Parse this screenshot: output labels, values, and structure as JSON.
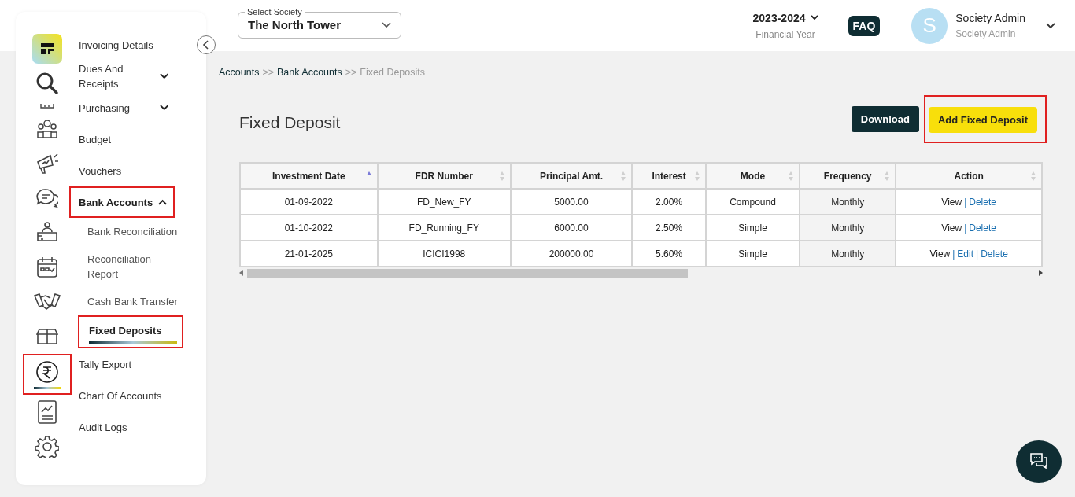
{
  "rail": [
    {
      "kind": "logo",
      "selected": false,
      "highlighted": false
    },
    {
      "kind": "search",
      "selected": false,
      "highlighted": false
    },
    {
      "kind": "partial",
      "selected": false,
      "highlighted": false
    },
    {
      "kind": "people",
      "selected": false,
      "highlighted": false
    },
    {
      "kind": "megaphone",
      "selected": false,
      "highlighted": false
    },
    {
      "kind": "chat",
      "selected": false,
      "highlighted": false
    },
    {
      "kind": "desk",
      "selected": false,
      "highlighted": false
    },
    {
      "kind": "calendar",
      "selected": false,
      "highlighted": false
    },
    {
      "kind": "handshake",
      "selected": false,
      "highlighted": false
    },
    {
      "kind": "box",
      "selected": false,
      "highlighted": false
    },
    {
      "kind": "rupee",
      "selected": true,
      "highlighted": true
    },
    {
      "kind": "report",
      "selected": false,
      "highlighted": false
    },
    {
      "kind": "gear",
      "selected": false,
      "highlighted": false
    }
  ],
  "menu": [
    {
      "label": "Invoicing Details",
      "selected": false,
      "highlighted": false
    },
    {
      "label": "Dues And Receipts",
      "selected": false,
      "highlighted": false,
      "expanded": false
    },
    {
      "label": "Purchasing",
      "selected": false,
      "highlighted": false,
      "expanded": false
    },
    {
      "label": "Budget",
      "selected": false,
      "highlighted": false
    },
    {
      "label": "Vouchers",
      "selected": false,
      "highlighted": false
    },
    {
      "label": "Bank Accounts",
      "selected": true,
      "highlighted": true,
      "expanded": true,
      "children": [
        {
          "label": "Bank Reconciliation",
          "selected": false,
          "highlighted": false
        },
        {
          "label": "Reconciliation Report",
          "selected": false,
          "highlighted": false
        },
        {
          "label": "Cash Bank Transfer",
          "selected": false,
          "highlighted": false
        },
        {
          "label": "Fixed Deposits",
          "selected": true,
          "highlighted": true
        }
      ]
    },
    {
      "label": "Tally Export",
      "selected": false,
      "highlighted": false
    },
    {
      "label": "Chart Of Accounts",
      "selected": false,
      "highlighted": false
    },
    {
      "label": "Audit Logs",
      "selected": false,
      "highlighted": false
    }
  ],
  "header": {
    "society_label": "Select Society",
    "society": "The North Tower",
    "year": "2023-2024",
    "year_caption": "Financial Year",
    "faq": "FAQ",
    "avatar_letter": "S",
    "user_name": "Society Admin",
    "user_role": "Society Admin"
  },
  "breadcrumb": [
    {
      "label": "Accounts",
      "current": false
    },
    {
      "label": "Bank Accounts",
      "current": false
    },
    {
      "label": "Fixed Deposits",
      "current": true
    }
  ],
  "breadcrumb_separator": ">>",
  "page_title": "Fixed Deposit",
  "buttons": [
    {
      "label": "Download",
      "kind": "dark",
      "highlighted": false
    },
    {
      "label": "Add Fixed Deposit",
      "kind": "primary",
      "highlighted": true
    }
  ],
  "table": {
    "action_separator": "|",
    "columns": [
      {
        "label": "Investment Date",
        "sorted": true
      },
      {
        "label": "FDR Number",
        "sorted": false
      },
      {
        "label": "Principal Amt.",
        "sorted": false
      },
      {
        "label": "Interest",
        "sorted": false
      },
      {
        "label": "Mode",
        "sorted": false
      },
      {
        "label": "Frequency",
        "sorted": false
      },
      {
        "label": "Action",
        "sorted": false
      }
    ],
    "rows": [
      {
        "cells": [
          "01-09-2022",
          "FD_New_FY",
          "5000.00",
          "2.00%",
          "Compound",
          "Monthly"
        ],
        "actions": [
          "View",
          "Delete"
        ]
      },
      {
        "cells": [
          "01-10-2022",
          "FD_Running_FY",
          "6000.00",
          "2.50%",
          "Simple",
          "Monthly"
        ],
        "actions": [
          "View",
          "Delete"
        ]
      },
      {
        "cells": [
          "21-01-2025",
          "ICICI1998",
          "200000.00",
          "5.60%",
          "Simple",
          "Monthly"
        ],
        "actions": [
          "View",
          "Edit",
          "Delete"
        ]
      }
    ]
  }
}
